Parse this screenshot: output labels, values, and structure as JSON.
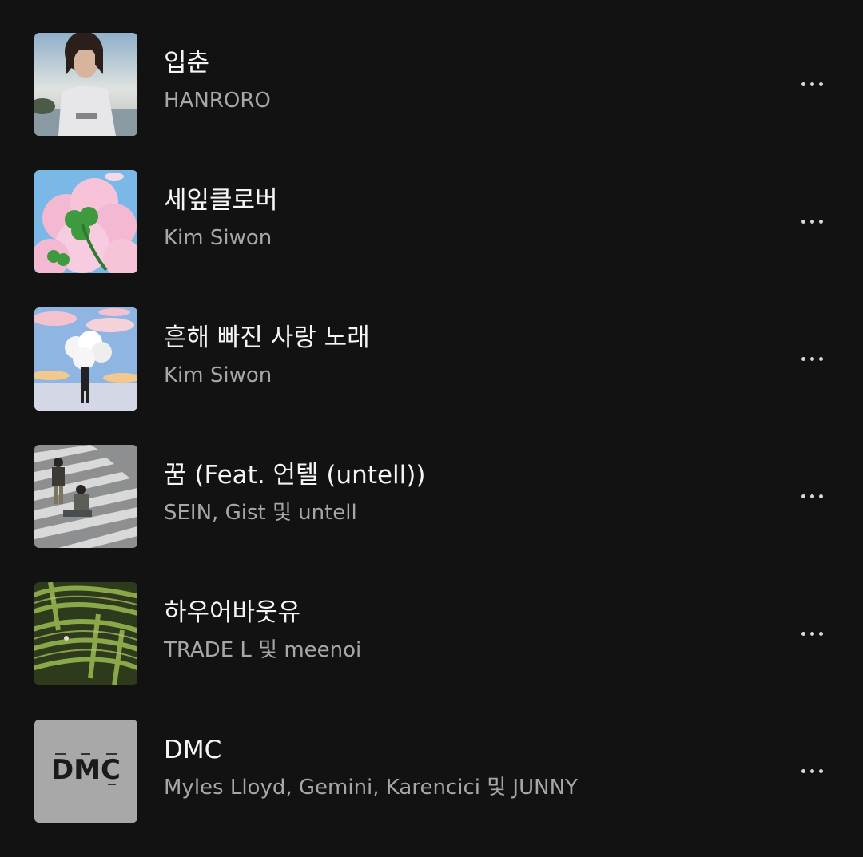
{
  "tracks": [
    {
      "title": "입춘",
      "artist": "HANRORO",
      "cover_icon": "photo-girl-seaside"
    },
    {
      "title": "세잎클로버",
      "artist": "Kim Siwon",
      "cover_icon": "clover-pink-cloud"
    },
    {
      "title": "흔해 빠진 사랑 노래",
      "artist": "Kim Siwon",
      "cover_icon": "flower-head-illustration"
    },
    {
      "title": "꿈 (Feat. 언텔 (untell))",
      "artist": "SEIN, Gist 및 untell",
      "cover_icon": "crosswalk-photo"
    },
    {
      "title": "하우어바웃유",
      "artist": "TRADE L 및 meenoi",
      "cover_icon": "hedge-maze"
    },
    {
      "title": "DMC",
      "artist": "Myles Lloyd, Gemini, Karencici 및 JUNNY",
      "cover_icon": "dmc-logo",
      "cover_text": "DMC"
    }
  ],
  "colors": {
    "background": "#121212",
    "title": "#f5f5f5",
    "artist": "#a7a7a7"
  },
  "more_icon": "more-horizontal-icon"
}
